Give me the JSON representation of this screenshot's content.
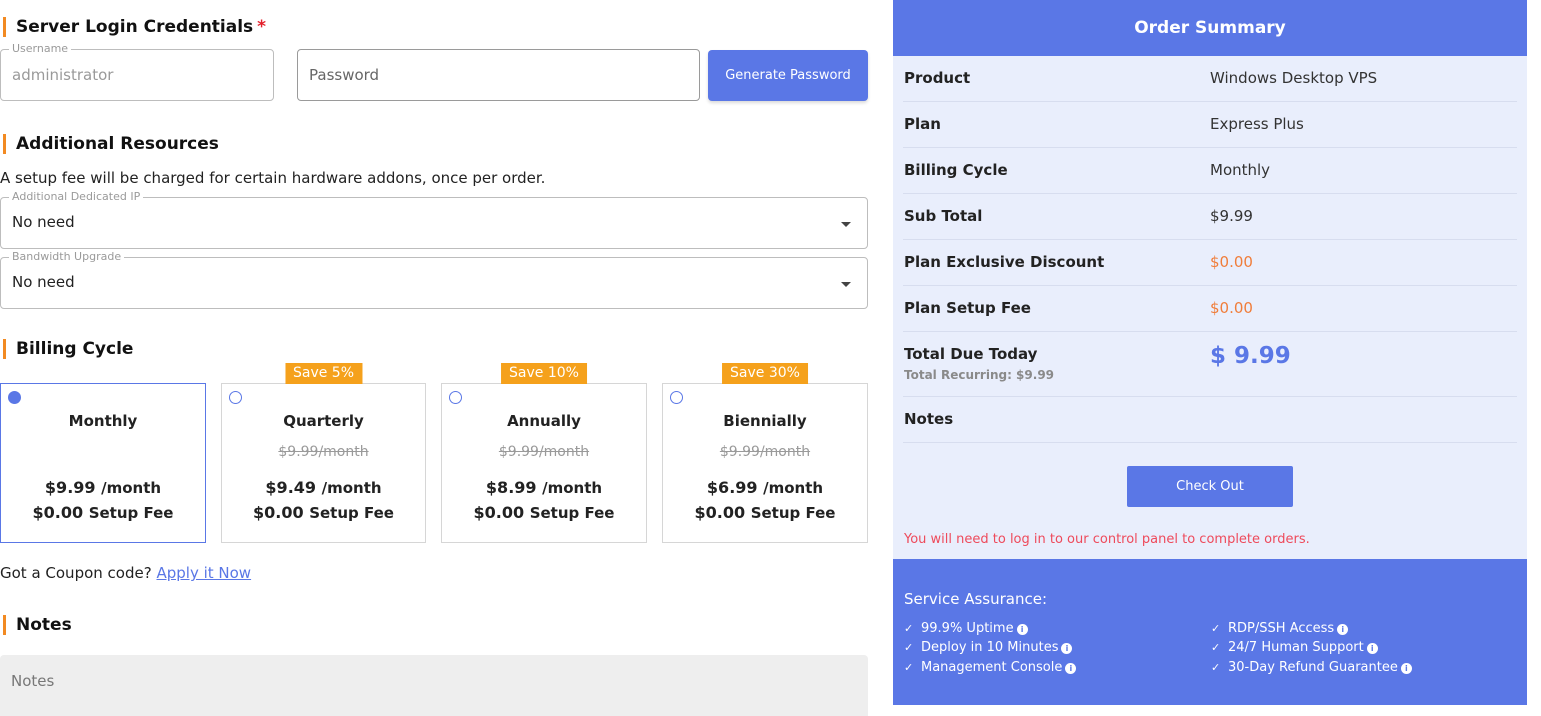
{
  "credentials": {
    "title": "Server Login Credentials",
    "required_mark": "*",
    "username_legend": "Username",
    "username_value": "administrator",
    "password_placeholder": "Password",
    "generate_label": "Generate Password"
  },
  "resources": {
    "title": "Additional Resources",
    "note": "A setup fee will be charged for certain hardware addons, once per order.",
    "dedicated_ip_legend": "Additional Dedicated IP",
    "dedicated_ip_value": "No need",
    "bandwidth_legend": "Bandwidth Upgrade",
    "bandwidth_value": "No need"
  },
  "billing": {
    "title": "Billing Cycle",
    "setup_label": "Setup Fee",
    "per_month": "/month",
    "cycles": [
      {
        "name": "Monthly",
        "badge": "",
        "old": "",
        "price": "$9.99",
        "setup": "$0.00",
        "selected": true
      },
      {
        "name": "Quarterly",
        "badge": "Save 5%",
        "old": "$9.99/month",
        "price": "$9.49",
        "setup": "$0.00",
        "selected": false
      },
      {
        "name": "Annually",
        "badge": "Save 10%",
        "old": "$9.99/month",
        "price": "$8.99",
        "setup": "$0.00",
        "selected": false
      },
      {
        "name": "Biennially",
        "badge": "Save 30%",
        "old": "$9.99/month",
        "price": "$6.99",
        "setup": "$0.00",
        "selected": false
      }
    ]
  },
  "coupon": {
    "text": "Got a Coupon code?",
    "link": "Apply it Now"
  },
  "notes": {
    "title": "Notes",
    "placeholder": "Notes"
  },
  "summary": {
    "title": "Order Summary",
    "rows": [
      {
        "k": "Product",
        "v": "Windows Desktop VPS"
      },
      {
        "k": "Plan",
        "v": "Express Plus"
      },
      {
        "k": "Billing Cycle",
        "v": "Monthly"
      },
      {
        "k": "Sub Total",
        "v": "$9.99"
      },
      {
        "k": "Plan Exclusive Discount",
        "v": "$0.00"
      },
      {
        "k": "Plan Setup Fee",
        "v": "$0.00"
      }
    ],
    "total_label": "Total Due Today",
    "total_recurring": "Total Recurring: $9.99",
    "total_value": "$ 9.99",
    "notes_label": "Notes",
    "checkout_label": "Check Out",
    "warning": "You will need to log in to our control panel to complete orders."
  },
  "assurance": {
    "title": "Service Assurance:",
    "left": [
      "99.9% Uptime",
      "Deploy in 10 Minutes",
      "Management Console"
    ],
    "right": [
      "RDP/SSH Access",
      "24/7 Human Support",
      "30-Day Refund Guarantee"
    ]
  },
  "colors": {
    "accent": "#5a77e6",
    "section_marker": "#f28a22",
    "badge": "#f5a11c",
    "discount": "#f07d3a",
    "warning": "#ee4a5b"
  }
}
